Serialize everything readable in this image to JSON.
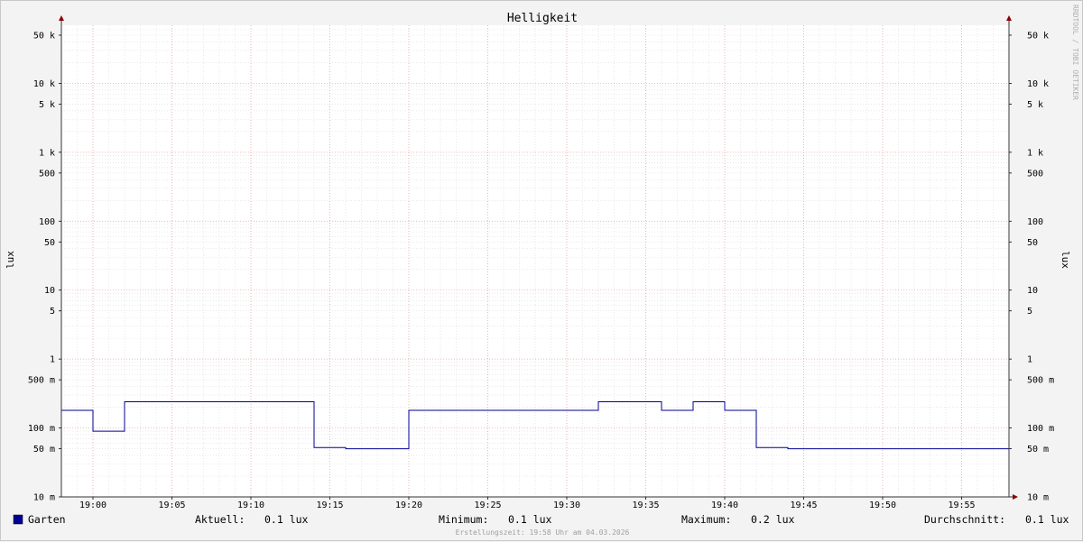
{
  "chart_data": {
    "type": "line",
    "title": "Helligkeit",
    "ylabel": "lux",
    "ylabel_right": "lux",
    "y_scale": "log",
    "ylim": [
      10,
      70000
    ],
    "xlim": [
      "18:58",
      "19:58"
    ],
    "grid": true,
    "y_ticks": [
      {
        "v": 50000,
        "label": "50 k"
      },
      {
        "v": 10000,
        "label": "10 k"
      },
      {
        "v": 5000,
        "label": "5 k"
      },
      {
        "v": 1000,
        "label": "1 k"
      },
      {
        "v": 500,
        "label": "500"
      },
      {
        "v": 100,
        "label": "100"
      },
      {
        "v": 50,
        "label": "50"
      },
      {
        "v": 10,
        "label": "10"
      },
      {
        "v": 5,
        "label": "5"
      },
      {
        "v": 1,
        "label": "1"
      },
      {
        "v": 0.5,
        "label": "500 m"
      },
      {
        "v": 0.1,
        "label": "100 m"
      },
      {
        "v": 0.05,
        "label": "50 m"
      },
      {
        "v": 0.01,
        "label": "10 m"
      }
    ],
    "x_ticks": [
      "19:00",
      "19:05",
      "19:10",
      "19:15",
      "19:20",
      "19:25",
      "19:30",
      "19:35",
      "19:40",
      "19:45",
      "19:50",
      "19:55"
    ],
    "series": [
      {
        "name": "Garten",
        "color": "#000096",
        "step": true,
        "points": [
          {
            "x": "18:58",
            "y": 0.18
          },
          {
            "x": "19:00",
            "y": 0.09
          },
          {
            "x": "19:02",
            "y": 0.24
          },
          {
            "x": "19:14",
            "y": 0.052
          },
          {
            "x": "19:16",
            "y": 0.05
          },
          {
            "x": "19:20",
            "y": 0.18
          },
          {
            "x": "19:32",
            "y": 0.24
          },
          {
            "x": "19:36",
            "y": 0.18
          },
          {
            "x": "19:38",
            "y": 0.24
          },
          {
            "x": "19:40",
            "y": 0.18
          },
          {
            "x": "19:42",
            "y": 0.052
          },
          {
            "x": "19:44",
            "y": 0.05
          },
          {
            "x": "19:58",
            "y": 0.05
          }
        ]
      }
    ]
  },
  "legend": {
    "series_name": "Garten",
    "series_color": "#000096",
    "current_label": "Aktuell:",
    "current_value": "0.1 lux",
    "min_label": "Minimum:",
    "min_value": "0.1 lux",
    "max_label": "Maximum:",
    "max_value": "0.2 lux",
    "avg_label": "Durchschnitt:",
    "avg_value": "0.1 lux"
  },
  "footer": "Erstellungszeit: 19:58 Uhr am 04.03.2026",
  "watermark": "RRDTOOL / TOBI OETIKER"
}
